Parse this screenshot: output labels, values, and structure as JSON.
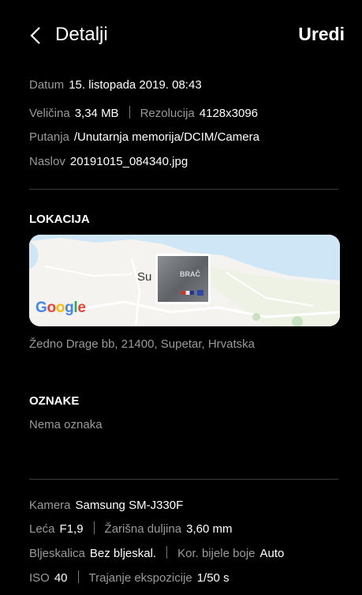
{
  "header": {
    "title": "Detalji",
    "edit_label": "Uredi",
    "back_icon": "chevron-left-icon"
  },
  "file_info": {
    "date": {
      "label": "Datum",
      "value": "15. listopada 2019. 08:43"
    },
    "size": {
      "label": "Veličina",
      "value": "3,34 MB"
    },
    "resolution": {
      "label": "Rezolucija",
      "value": "4128x3096"
    },
    "path": {
      "label": "Putanja",
      "value": "/Unutarnja memorija/DCIM/Camera"
    },
    "name": {
      "label": "Naslov",
      "value": "20191015_084340.jpg"
    }
  },
  "location": {
    "heading": "LOKACIJA",
    "map_town_label": "Su",
    "map_provider": "Google",
    "thumbnail_text": "BRAČ",
    "address": "Žedno Drage bb, 21400, Supetar, Hrvatska"
  },
  "tags": {
    "heading": "OZNAKE",
    "empty_text": "Nema oznaka"
  },
  "camera_info": {
    "camera": {
      "label": "Kamera",
      "value": "Samsung SM-J330F"
    },
    "lens": {
      "label": "Leća",
      "value": "F1,9"
    },
    "focal_length": {
      "label": "Žarišna duljina",
      "value": "3,60 mm"
    },
    "flash": {
      "label": "Bljeskalica",
      "value": "Bez bljeskal."
    },
    "white_balance": {
      "label": "Kor. bijele boje",
      "value": "Auto"
    },
    "iso": {
      "label": "ISO",
      "value": "40"
    },
    "exposure": {
      "label": "Trajanje ekspozicije",
      "value": "1/50 s"
    }
  },
  "colors": {
    "background": "#000000",
    "label": "#9a9a9a",
    "value": "#ffffff",
    "divider": "#3a3a3a"
  }
}
